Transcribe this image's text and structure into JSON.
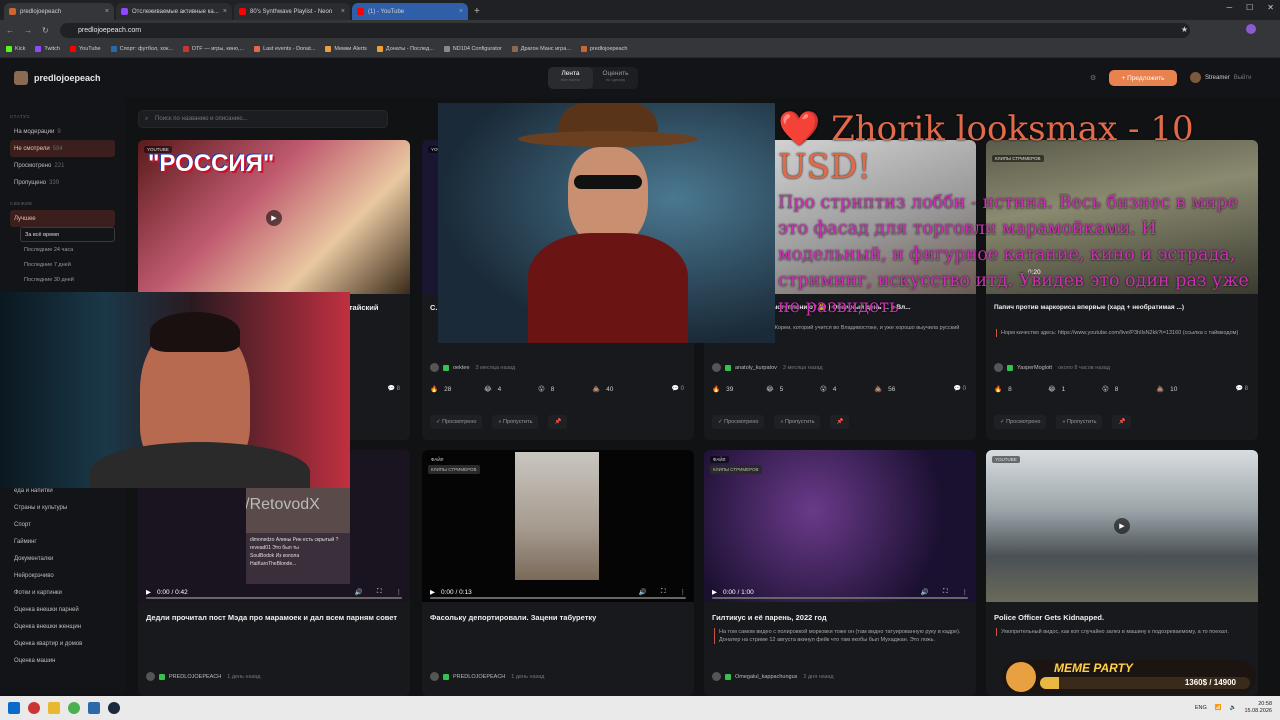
{
  "browser": {
    "tabs": [
      {
        "label": "predlojoepeach",
        "color": "#cc6633"
      },
      {
        "label": "Отслеживаемые активные ка...",
        "color": "#9146ff"
      },
      {
        "label": "80's Synthwave Playlist - Neon",
        "color": "#ff0000"
      },
      {
        "label": "(1) - YouTube",
        "color": "#ff0000"
      }
    ],
    "url": "predlojoepeach.com",
    "bookmarks": [
      "Kick",
      "Twitch",
      "YouTube",
      "Спорт: футбол, хок...",
      "DTF — игры, кино,...",
      "Last events - Donat...",
      "Мемки Alerts",
      "Донаты - Послед...",
      "ND104 Configurator",
      "Драгон Манс игра...",
      "predlojoepeach"
    ]
  },
  "header": {
    "site_name": "predlojoepeach",
    "feed_tab": "Лента",
    "feed_sub": "все посты",
    "rate_tab": "Оценить",
    "rate_sub": "по одному",
    "suggest_button": "+ Предложить",
    "user_name": "Streamer",
    "logout": "Выйти"
  },
  "search": {
    "placeholder": "Поиск по названию и описанию..."
  },
  "sidebar": {
    "status_head": "СТАТУС",
    "status": [
      {
        "label": "На модерации",
        "count": "9"
      },
      {
        "label": "Не смотрели",
        "count": "584"
      },
      {
        "label": "Просмотрено",
        "count": "221"
      },
      {
        "label": "Пропущено",
        "count": "339"
      }
    ],
    "sort_head": "СВЕЖИЕ",
    "best": "Лучшее",
    "periods": [
      "За всё время",
      "Последние 24 часа",
      "Последние 7 дней",
      "Последние 30 дней"
    ],
    "categories": [
      "еда и напитки",
      "Страны и культуры",
      "Спорт",
      "Гайминг",
      "Документалки",
      "Нейрокрэчиво",
      "Фотки и картинки",
      "Оценка внешки парней",
      "Оценка внешки женщин",
      "Оценка квартир и домов",
      "Оценка машин"
    ]
  },
  "cards_top": [
    {
      "source": "YOUTUBE",
      "thumb_text": "\"РОССИЯ\"",
      "title": "...итайский",
      "user": "",
      "ago": "",
      "reacts": [],
      "comments": "8"
    },
    {
      "source": "YOUTUBE",
      "title": "С... П...",
      "user": "oektee",
      "ago": "3 месяца назад",
      "reacts": [
        "28",
        "4",
        "8",
        "40"
      ],
      "comments": "0",
      "viewed": "✓ Просмотрено",
      "skip": "» Пропустить"
    },
    {
      "source": "",
      "title": "...ы готовиться к выступлению? 🤔 | Обычный день ... в Вл...",
      "desc": "...тудентка из Южной Кореи, которий учится во Владивостоке, и уже хорошо выучила русский язык.",
      "user": "anatoly_kurpatov",
      "ago": "3 месяца назад",
      "reacts": [
        "39",
        "5",
        "4",
        "56"
      ],
      "comments": "0",
      "viewed": "✓ Просмотрено",
      "skip": "» Пропустить"
    },
    {
      "source": "",
      "badge": "КЛИПЫ СТРИМЕРОВ",
      "title": "Папич против маркориса впервые (хард + необратимая ...)",
      "desc": "Норм качество здесь: https://www.youtube.com/live/P3hIlsN2kk?t=13160 (ссылка с таймкодом)",
      "user": "YasperMoglott",
      "ago": "около 8 часов назад",
      "reacts": [
        "8",
        "1",
        "8",
        "10"
      ],
      "comments": "8",
      "viewed": "✓ Просмотрено",
      "skip": "» Пропустить",
      "time": "0:20"
    }
  ],
  "cards_bottom": [
    {
      "source": "",
      "badge": "",
      "time": "0:00 / 0:42",
      "title": "Дедли прочитал пост Мэда про марамоек и дал всем парням совет",
      "user": "PREDLOJOEPEACH",
      "ago": "1 день назад"
    },
    {
      "source": "ФАЙЛ",
      "badge": "КЛИПЫ СТРИМЕРОВ",
      "time": "0:00 / 0:13",
      "title": "Фасольку депортировали. Зацени табуретку",
      "user": "PREDLOJOEPEACH",
      "ago": "1 день назад"
    },
    {
      "source": "ФАЙЛ",
      "badge": "КЛИПЫ СТРИМЕРОВ",
      "time": "0:00 / 1:00",
      "title": "Гилтикус и её парень, 2022 год",
      "desc": "На том самом видео с полировкой морковки тоже он (там видно татуированную руку в кадре). Донатер на стриме 12 августа вкинул фейк что там якобы был Мухаджан. Это ложь.",
      "user": "Omegalul_kappachungus",
      "ago": "2 дня назад"
    },
    {
      "source": "YOUTUBE",
      "badge": "",
      "title": "Police Officer Gets Kidnapped.",
      "desc": "Умопрительный видос, как коп случайно залез в машину к подозреваемому, а то поехал.",
      "user": "",
      "ago": ""
    }
  ],
  "stream_overlay": {
    "donate_title": "❤️ Zhorik looksmax - 10 USD!",
    "donate_message": "Про стриптиз лобби - истина. Весь бизнес в мире это фасад для торговли марамойками. И модельный, и фигурное катание, кино и эстрада, стриминг, искусство итд. Увидев это один раз уже не развидеть",
    "webcam_chat": [
      "dimonedzo Алины Рин есть скрытый ?",
      "revead01 Это был ты",
      "SoulBodok Из колола",
      "HaiKaroTheBlonde..."
    ],
    "watermark": "t.me/RetovodX",
    "meme_label": "MEME PARTY",
    "meme_progress": "1360$ / 14900"
  },
  "taskbar": {
    "lang": "ENG",
    "time": "20:58",
    "date": "15.08.2026"
  }
}
